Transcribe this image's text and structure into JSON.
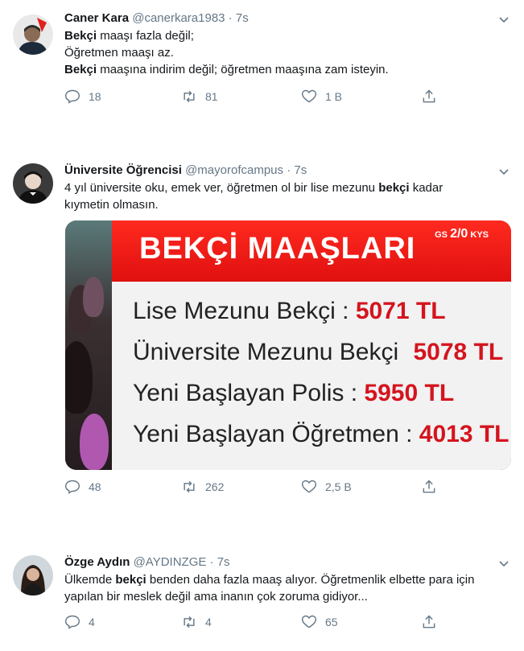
{
  "tweets": [
    {
      "name": "Caner Kara",
      "handle": "@canerkara1983",
      "sep": "·",
      "time": "7s",
      "lines": [
        {
          "bold": "Bekçi",
          "rest": " maaşı fazla değil;"
        },
        {
          "bold": "",
          "rest": "Öğretmen maaşı az."
        },
        {
          "bold": "Bekçi",
          "rest": " maaşına indirim değil; öğretmen maaşına zam isteyin."
        }
      ],
      "replies": "18",
      "retweets": "81",
      "likes": "1 B"
    },
    {
      "name": "Üniversite Öğrencisi",
      "handle": "@mayorofcampus",
      "sep": "·",
      "time": "7s",
      "text_pre": "4 yıl üniversite oku, emek ver, öğretmen ol bir lise mezunu ",
      "text_bold": "bekçi",
      "text_post": " kadar",
      "text_line2": "kıymetin olmasın.",
      "replies": "48",
      "retweets": "262",
      "likes": "2,5 B",
      "image": {
        "title": "BEKÇİ MAAŞLARI",
        "corner_prefix": "GS",
        "corner_score": "2/0",
        "corner_suffix": "KYS",
        "rows": [
          {
            "label": "Lise Mezunu Bekçi :",
            "amount": "5071 TL"
          },
          {
            "label": "Üniversite Mezunu Bekçi",
            "amount": "5078 TL"
          },
          {
            "label": "Yeni Başlayan Polis :",
            "amount": "5950 TL"
          },
          {
            "label": "Yeni Başlayan Öğretmen :",
            "amount": "4013 TL"
          }
        ]
      }
    },
    {
      "name": "Özge Aydın",
      "handle": "@AYDINZGE",
      "sep": "·",
      "time": "7s",
      "text_pre": "Ülkemde ",
      "text_bold": "bekçi",
      "text_post": " benden daha fazla maaş alıyor. Öğretmenlik elbette para için",
      "text_line2": "yapılan bir meslek değil ama inanın çok zoruma gidiyor...",
      "replies": "4",
      "retweets": "4",
      "likes": "65"
    }
  ],
  "colors": {
    "text": "#14171a",
    "muted": "#657786",
    "accent_red": "#d4141e"
  }
}
